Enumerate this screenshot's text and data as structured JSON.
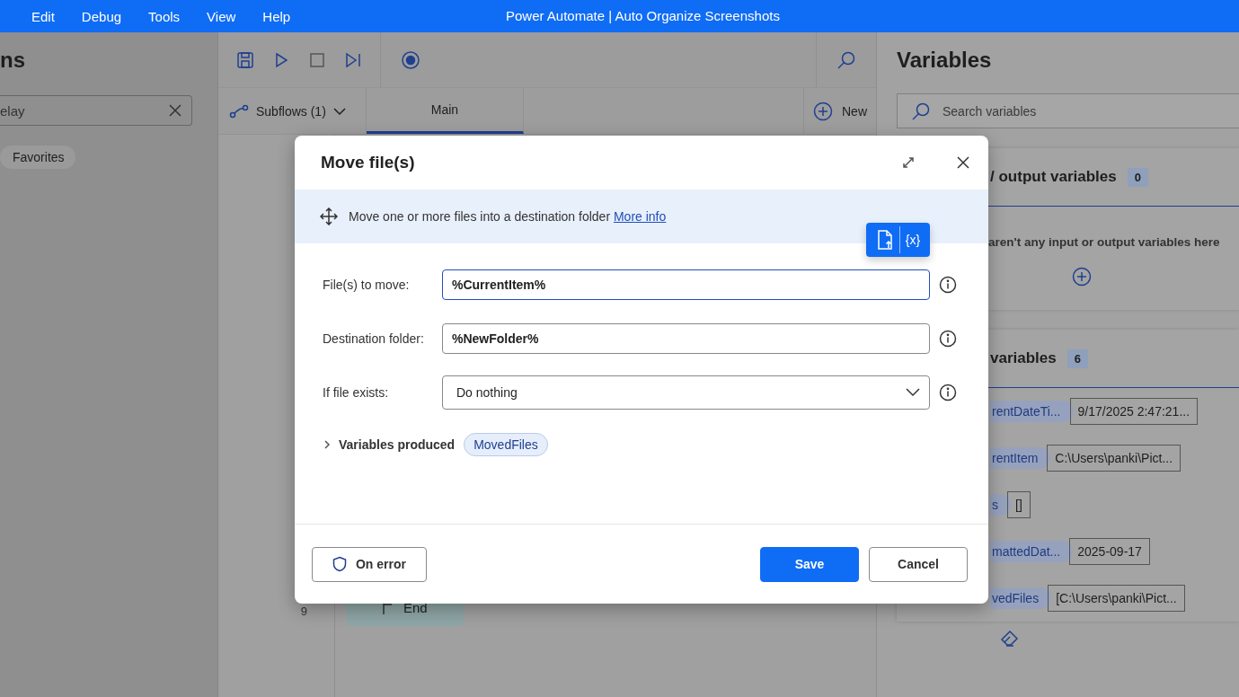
{
  "title_bar": {
    "menu": [
      "Edit",
      "Debug",
      "Tools",
      "View",
      "Help"
    ],
    "title": "Power Automate | Auto Organize Screenshots"
  },
  "actions_pane": {
    "title": "ns",
    "search": {
      "value": "elay"
    },
    "chips": [
      "Favorites"
    ]
  },
  "editor": {
    "subflows": "Subflows (1)",
    "tabs": [
      {
        "label": "Main",
        "selected": true
      }
    ],
    "new_button": "New",
    "lines": [
      {
        "number": "9",
        "text": "End"
      }
    ]
  },
  "variables_pane": {
    "title": "Variables",
    "search": {
      "placeholder": "Search variables"
    },
    "sections": [
      {
        "title": "/ output variables",
        "count": "0",
        "empty_text": "aren't any input or output variables here"
      },
      {
        "title": "variables",
        "count": "6",
        "variables": [
          {
            "name": "rentDateTi...",
            "value": "9/17/2025 2:47:21..."
          },
          {
            "name": "rentItem",
            "value": "C:\\Users\\panki\\Pict..."
          },
          {
            "name": "s",
            "value": "[]"
          },
          {
            "name": "mattedDat...",
            "value": "2025-09-17"
          },
          {
            "name": "vedFiles",
            "value": "[C:\\Users\\panki\\Pict..."
          }
        ]
      }
    ]
  },
  "dialog": {
    "title": "Move file(s)",
    "description": "Move one or more files into a destination folder",
    "link": "More info",
    "fields": [
      {
        "kind": "text",
        "label": "File(s) to move:",
        "value": "%CurrentItem%",
        "focused": true
      },
      {
        "kind": "text",
        "label": "Destination folder:",
        "value": "%NewFolder%",
        "focused": false
      },
      {
        "kind": "select",
        "label": "If file exists:",
        "value": "Do nothing",
        "focused": false
      }
    ],
    "variables_produced": {
      "label": "Variables produced",
      "expanded": false,
      "chips": [
        "MovedFiles"
      ]
    },
    "variable_button": "{x}",
    "on_error": "On error",
    "save": "Save",
    "cancel": "Cancel"
  }
}
